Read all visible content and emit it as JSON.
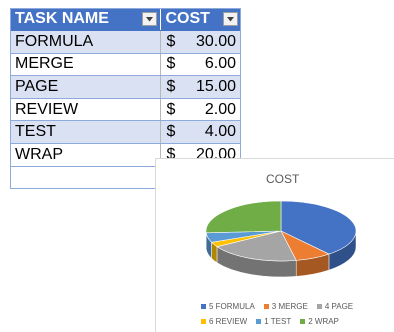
{
  "table": {
    "headers": {
      "task": "TASK NAME",
      "cost": "COST"
    },
    "rows": [
      {
        "task": "FORMULA",
        "currency": "$",
        "amount": "30.00"
      },
      {
        "task": "MERGE",
        "currency": "$",
        "amount": "6.00"
      },
      {
        "task": "PAGE",
        "currency": "$",
        "amount": "15.00"
      },
      {
        "task": "REVIEW",
        "currency": "$",
        "amount": "2.00"
      },
      {
        "task": "TEST",
        "currency": "$",
        "amount": "4.00"
      },
      {
        "task": "WRAP",
        "currency": "$",
        "amount": "20.00"
      }
    ],
    "header_color": "#4472c4",
    "band_color": "#d9e1f2"
  },
  "chart_data": {
    "type": "pie",
    "title": "COST",
    "categories": [
      "FORMULA",
      "MERGE",
      "PAGE",
      "REVIEW",
      "TEST",
      "WRAP"
    ],
    "values": [
      30,
      6,
      15,
      2,
      4,
      20
    ],
    "colors": [
      "#4472c4",
      "#ed7d31",
      "#a5a5a5",
      "#ffc000",
      "#5b9bd5",
      "#70ad47"
    ],
    "style": "3d-pie",
    "legend_position": "bottom",
    "legend": [
      [
        "5 FORMULA",
        "3 MERGE",
        "4 PAGE"
      ],
      [
        "6 REVIEW",
        "1 TEST",
        "2 WRAP"
      ]
    ]
  }
}
